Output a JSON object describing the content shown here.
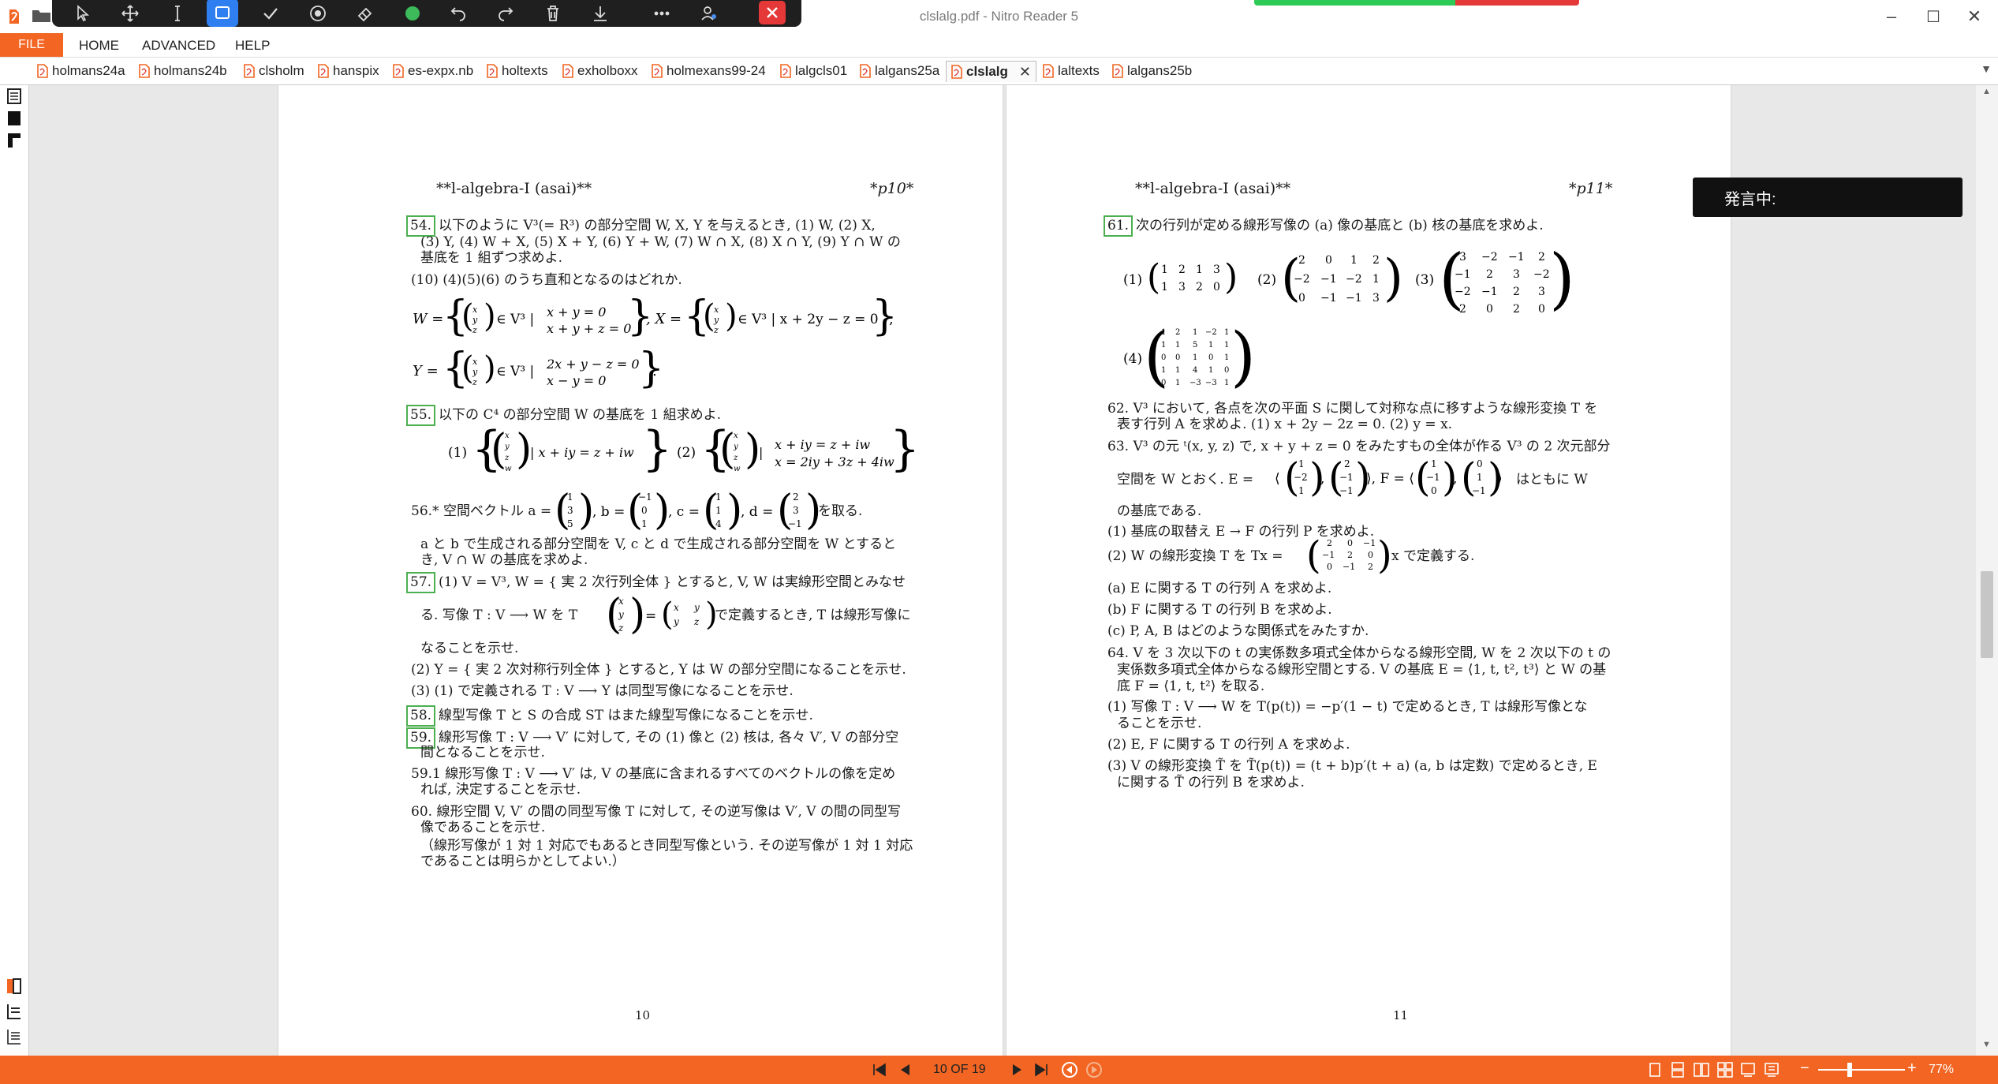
{
  "window": {
    "title": "clslalg.pdf - Nitro Reader 5",
    "minimize": "–",
    "maximize": "☐",
    "close": "✕"
  },
  "colors": {
    "accent": "#f26522",
    "tab_highlight": "#4caf50",
    "progress_green": "#2dcb55",
    "progress_red": "#e53838"
  },
  "progress": {
    "green_fraction": 0.62
  },
  "toolbar_icons": [
    "pointer-icon",
    "move-icon",
    "text-cursor-icon",
    "rectangle-icon",
    "check-icon",
    "record-icon",
    "eraser-icon",
    "green-dot-icon",
    "undo-icon",
    "redo-icon",
    "trash-icon",
    "download-icon",
    "more-icon",
    "user-icon",
    "close-icon"
  ],
  "menu": {
    "file": "FILE",
    "items": [
      "HOME",
      "ADVANCED",
      "HELP"
    ]
  },
  "tabs": [
    {
      "label": "holmans24a",
      "active": false
    },
    {
      "label": "holmans24b",
      "active": false
    },
    {
      "label": "clsholm",
      "active": false
    },
    {
      "label": "hanspix",
      "active": false
    },
    {
      "label": "es-expx.nb",
      "active": false
    },
    {
      "label": "holtexts",
      "active": false
    },
    {
      "label": "exholboxx",
      "active": false
    },
    {
      "label": "holmexans99-24",
      "active": false
    },
    {
      "label": "lalgcls01",
      "active": false
    },
    {
      "label": "lalgans25a",
      "active": false
    },
    {
      "label": "clslalg",
      "active": true
    },
    {
      "label": "laltexts",
      "active": false
    },
    {
      "label": "lalgans25b",
      "active": false
    }
  ],
  "tab_close": "✕",
  "speaking": "発言中:",
  "status": {
    "page_indicator": "10 OF 19",
    "zoom": "77%"
  },
  "page10": {
    "header_left": "**l-algebra-I (asai)**",
    "header_right": "*p10*",
    "page_number": "10",
    "lines": {
      "p54a_num": "54.",
      "p54a": "以下のように V³(= R³) の部分空間 W, X, Y を与えるとき, (1) W, (2) X,",
      "p54b": "(3) Y, (4) W + X, (5) X + Y, (6) Y + W, (7) W ∩ X, (8) X ∩ Y, (9) Y ∩ W の",
      "p54c": "基底を 1 組ずつ求めよ.",
      "p54d": "(10)  (4)(5)(6) のうち直和となるのはどれか.",
      "p55_num": "55.",
      "p55": "以下の C⁴ の部分空間 W の基底を 1 組求めよ.",
      "p56": "56.*  空間ベクトル a =",
      "p56_tail": "を取る.",
      "p56b": "a と b で生成される部分空間を V, c と d で生成される部分空間を W とすると",
      "p56c": "き, V ∩ W の基底を求めよ.",
      "p57_num": "57.",
      "p57a": "(1) V = V³, W = { 実 2 次行列全体 } とすると, V, W は実線形空間とみなせ",
      "p57b": "る. 写像 T : V ⟶ W を T",
      "p57b_tail": "で定義するとき, T は線形写像に",
      "p57c": "なることを示せ.",
      "p57d": "(2) Y = { 実 2 次対称行列全体 } とすると, Y は W の部分空間になることを示せ.",
      "p57e": "(3) (1) で定義される T : V ⟶ Y は同型写像になることを示せ.",
      "p58_num": "58.",
      "p58": "線型写像 T と S の合成 ST はまた線型写像になることを示せ.",
      "p59_num": "59.",
      "p59a": "線形写像 T : V ⟶ V′ に対して, その (1) 像と (2) 核は, 各々 V′, V の部分空",
      "p59b": "間となることを示せ.",
      "p591a": "59.1  線形写像 T : V ⟶ V′ は, V の基底に含まれるすべてのベクトルの像を定め",
      "p591b": "れば, 決定することを示せ.",
      "p60a": "60.  線形空間 V, V′ の間の同型写像 T に対して, その逆写像は V′, V の間の同型写",
      "p60b": "像であることを示せ.",
      "p60c": "（線形写像が 1 対 1 対応でもあるとき同型写像という. その逆写像が 1 対 1 対応",
      "p60d": "であることは明らかとしてよい.）"
    }
  },
  "page11": {
    "header_left": "**l-algebra-I (asai)**",
    "header_right": "*p11*",
    "page_number": "11",
    "lines": {
      "p61_num": "61.",
      "p61": "次の行列が定める線形写像の (a) 像の基底と (b) 核の基底を求めよ.",
      "p62a": "62.  V³ において, 各点を次の平面 S に関して対称な点に移すような線形変換 T を",
      "p62b": "表す行列 A を求めよ.     (1) x + 2y − 2z = 0.    (2) y = x.",
      "p63a": "63.  V³ の元 ᵗ(x, y, z) で, x + y + z = 0 をみたすもの全体が作る V³ の 2 次元部分",
      "p63b": "空間を W とおく. E =",
      "p63b_tail": "はともに W",
      "p63c": "の基底である.",
      "p63d": "(1)  基底の取替え E → F の行列 P を求めよ.",
      "p63e": "(2)  W の線形変換 T を Tx =",
      "p63e_tail": "x で定義する.",
      "p63f": "(a)  E に関する T の行列 A を求めよ.",
      "p63g": "(b)  F に関する T の行列 B を求めよ.",
      "p63h": "(c)  P, A, B はどのような関係式をみたすか.",
      "p64a": "64.  V を 3 次以下の t の実係数多項式全体からなる線形空間, W を 2 次以下の t の",
      "p64b": "実係数多項式全体からなる線形空間とする. V の基底 E = ⟨1, t, t², t³⟩ と W の基",
      "p64c": "底 F = ⟨1, t, t²⟩ を取る.",
      "p64d": "(1)  写像 T : V ⟶ W を T(p(t)) = −p′(1 − t) で定めるとき, T は線形写像とな",
      "p64e": "ることを示せ.",
      "p64f": "(2)  E, F に関する T の行列 A を求めよ.",
      "p64g": "(3)  V の線形変換 T̃ を T̃(p(t)) = (t + b)p′(t + a)  (a, b は定数) で定めるとき, E",
      "p64h": "に関する T̃ の行列 B を求めよ."
    }
  }
}
